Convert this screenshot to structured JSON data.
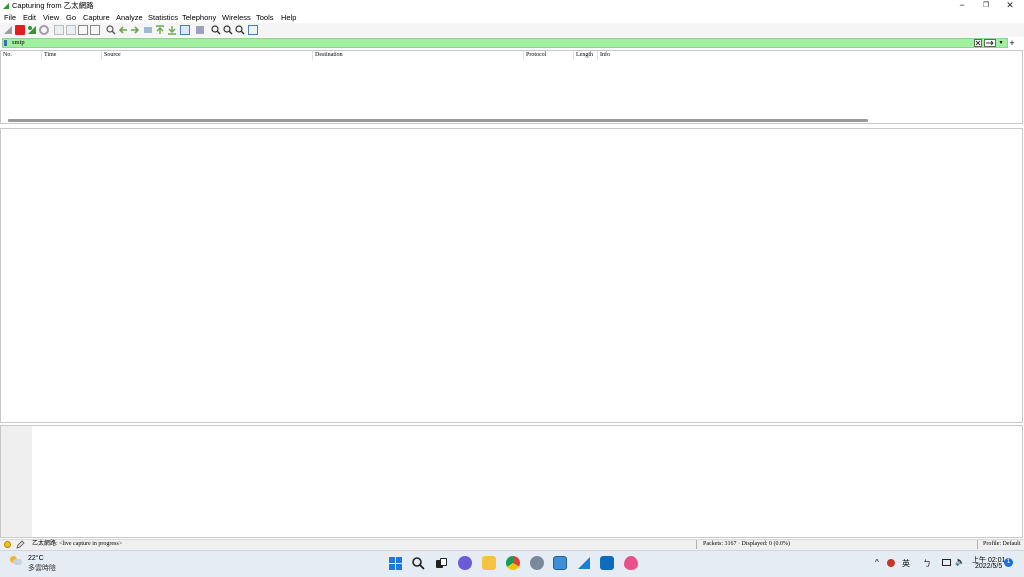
{
  "window": {
    "title": "Capturing from 乙太網路",
    "controls": {
      "minimize": "−",
      "maximize": "❐",
      "close": "✕"
    }
  },
  "menu": [
    "File",
    "Edit",
    "View",
    "Go",
    "Capture",
    "Analyze",
    "Statistics",
    "Telephony",
    "Wireless",
    "Tools",
    "Help"
  ],
  "filter": {
    "value": "smtp",
    "add_button": "+",
    "dropdown_icon": "▾"
  },
  "packet_list": {
    "columns": [
      "No.",
      "Time",
      "Source",
      "Destination",
      "Protocol",
      "Length",
      "Info"
    ],
    "rows": []
  },
  "status": {
    "capture": "乙太網路: <live capture in progress>",
    "packets": "Packets: 3167 · Displayed: 0 (0.0%)",
    "profile": "Profile: Default"
  },
  "taskbar": {
    "weather_temp": "22°C",
    "weather_desc": "多雲時陰",
    "ime_lang": "英",
    "clock_time": "上午 02:01",
    "clock_date": "2022/5/5",
    "notification_count": "1"
  },
  "colors": {
    "filter_valid": "#a0f0a0",
    "stop_button": "#e02020",
    "wireshark_fin": "#1a7fd0"
  }
}
